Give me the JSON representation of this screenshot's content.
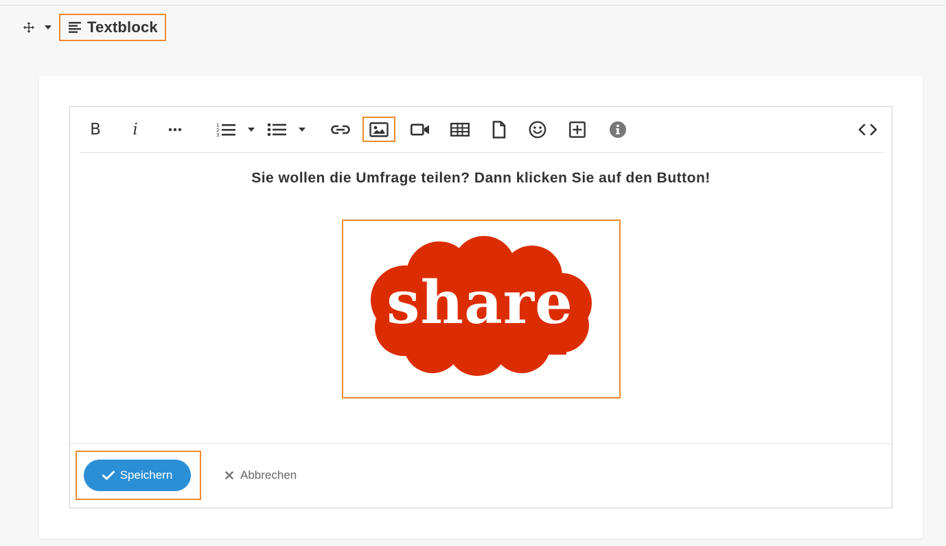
{
  "header": {
    "title": "Textblock",
    "icons": [
      "move-icon",
      "caret-down-icon",
      "align-left-icon"
    ]
  },
  "toolbar": {
    "bold_label": "B",
    "italic_label": "i",
    "items": [
      "bold",
      "italic",
      "more",
      "ordered-list",
      "list-options",
      "bullet-list",
      "list-options",
      "link",
      "image",
      "video",
      "table",
      "file",
      "emoji",
      "add",
      "info",
      "source-code"
    ],
    "active_item": "image"
  },
  "content": {
    "headline": "Sie wollen die Umfrage teilen? Dann klicken Sie auf den Button!",
    "image_text": "share",
    "image_color": "#dc2d02"
  },
  "footer": {
    "save_label": "Speichern",
    "cancel_label": "Abbrechen"
  },
  "colors": {
    "accent": "#2b8fd6",
    "highlight": "#f08a2e"
  }
}
